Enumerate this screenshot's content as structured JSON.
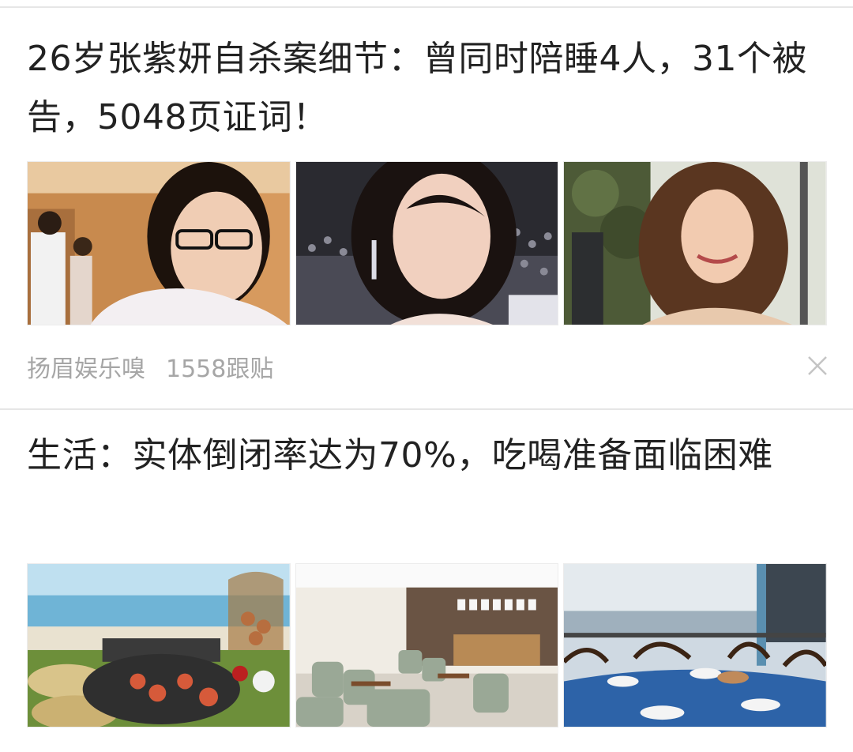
{
  "feed": [
    {
      "headline": "26岁张紫妍自杀案细节：曾同时陪睡4人，31个被告，5048页证词！",
      "source": "扬眉娱乐嗅",
      "comments": "1558跟贴",
      "dismiss_icon": "close-icon",
      "thumbnails": [
        "photo-woman-glasses",
        "photo-woman-earrings",
        "photo-woman-curly-hair"
      ]
    },
    {
      "headline": "生活：实体倒闭率达为70%，吃喝准备面临困难",
      "thumbnails": [
        "photo-seafood-platter",
        "photo-cafe-interior",
        "photo-restaurant-table"
      ]
    }
  ]
}
